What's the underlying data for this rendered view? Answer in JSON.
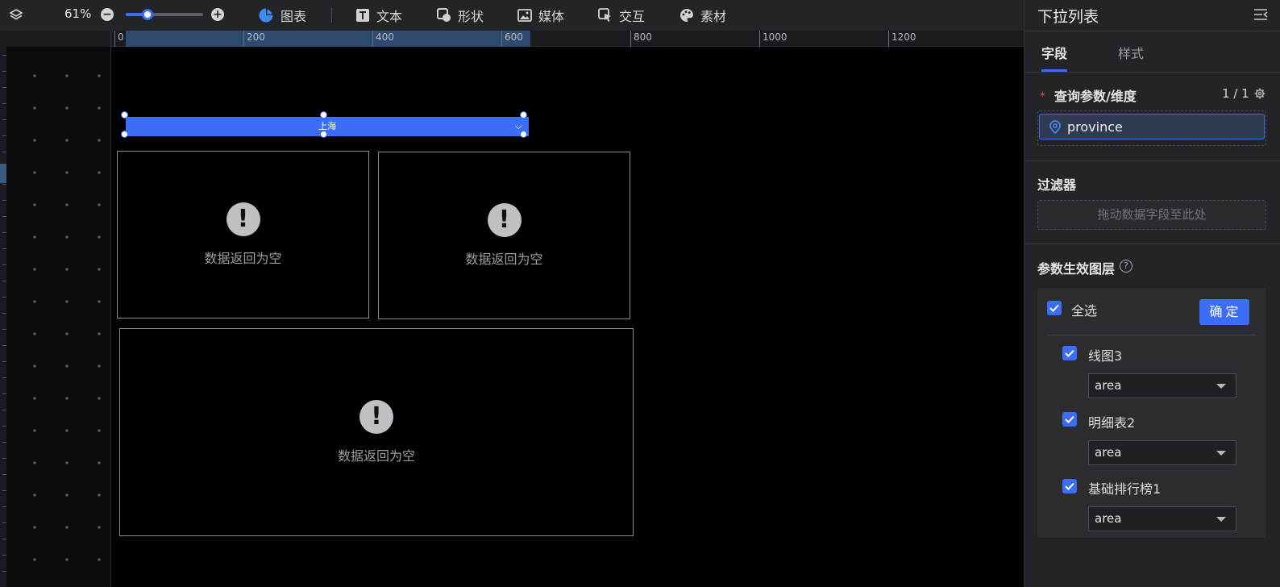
{
  "toolbar": {
    "zoom": "61%",
    "zoom_value": 0.28,
    "items": [
      {
        "label": "图表",
        "icon": "pie-chart-icon"
      },
      {
        "label": "文本",
        "icon": "text-icon"
      },
      {
        "label": "形状",
        "icon": "shape-icon"
      },
      {
        "label": "媒体",
        "icon": "image-icon"
      },
      {
        "label": "交互",
        "icon": "interaction-icon"
      },
      {
        "label": "素材",
        "icon": "palette-icon"
      }
    ]
  },
  "ruler": {
    "ticks": [
      "0",
      "200",
      "400",
      "600",
      "800",
      "1000",
      "1200"
    ]
  },
  "canvas": {
    "dropdown_value": "上海",
    "empty_text": "数据返回为空",
    "empty_count": 3
  },
  "panel": {
    "title": "下拉列表",
    "tabs": [
      "字段",
      "样式"
    ],
    "active_tab": "字段",
    "query_title": "查询参数/维度",
    "query_count": "1 / 1",
    "field_chip": "province",
    "filter_title": "过滤器",
    "filter_placeholder": "拖动数据字段至此处",
    "layer_title": "参数生效图层",
    "select_all": "全选",
    "confirm": "确定",
    "layers": [
      {
        "name": "线图3",
        "checked": true,
        "value": "area"
      },
      {
        "name": "明细表2",
        "checked": true,
        "value": "area"
      },
      {
        "name": "基础排行榜1",
        "checked": true,
        "value": "area"
      }
    ]
  },
  "colors": {
    "accent": "#3b6df6",
    "panel_bg": "#232427",
    "canvas_bg": "#000000"
  }
}
